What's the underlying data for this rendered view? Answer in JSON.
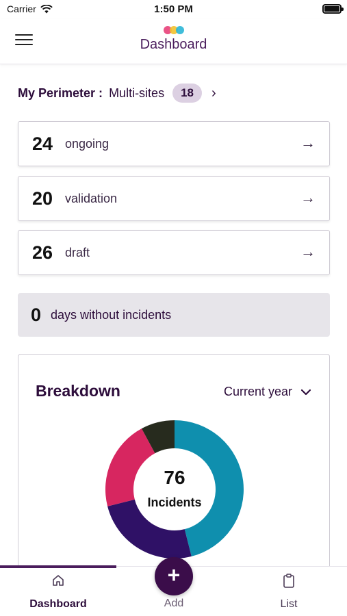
{
  "status_bar": {
    "carrier": "Carrier",
    "time": "1:50 PM"
  },
  "header": {
    "title": "Dashboard",
    "logo_colors": [
      "#e8407a",
      "#f2c12e",
      "#2bb6d6"
    ]
  },
  "perimeter": {
    "label": "My Perimeter :",
    "value": "Multi-sites",
    "count": "18"
  },
  "status_cards": [
    {
      "count": "24",
      "label": "ongoing"
    },
    {
      "count": "20",
      "label": "validation"
    },
    {
      "count": "26",
      "label": "draft"
    }
  ],
  "days_without_incidents": {
    "count": "0",
    "label": "days without incidents"
  },
  "breakdown": {
    "title": "Breakdown",
    "period": "Current year",
    "total": "76",
    "caption": "Incidents"
  },
  "chart_data": {
    "type": "pie",
    "donut": true,
    "total": 76,
    "slices": [
      {
        "value": 35,
        "color": "#0f8fae"
      },
      {
        "value": 19,
        "color": "#2f1166"
      },
      {
        "value": 16,
        "color": "#d72660"
      },
      {
        "value": 6,
        "color": "#272b1e"
      }
    ]
  },
  "bottom_nav": {
    "dashboard": "Dashboard",
    "add": "Add",
    "list": "List"
  },
  "colors": {
    "brand": "#3b0d4a",
    "accent_badge": "#dcd0e2"
  }
}
